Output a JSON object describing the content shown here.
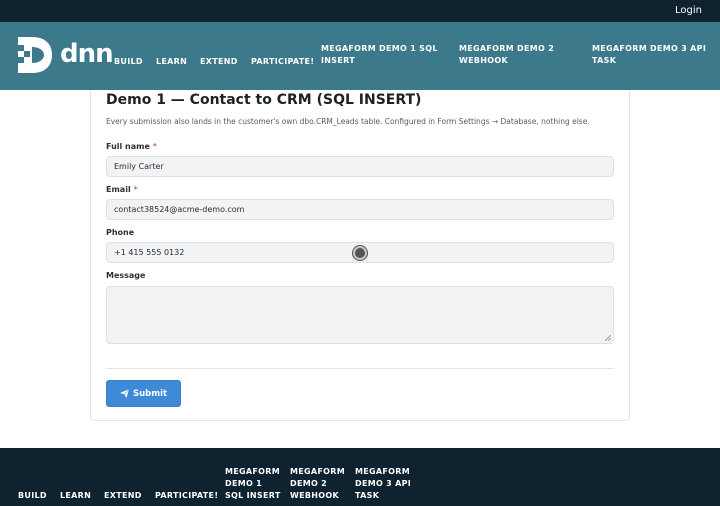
{
  "topbar": {
    "login_label": "Login"
  },
  "header": {
    "logo_text": "dnn",
    "nav": [
      {
        "label": "BUILD"
      },
      {
        "label": "LEARN"
      },
      {
        "label": "EXTEND"
      },
      {
        "label": "PARTICIPATE!"
      },
      {
        "label_line1": "MEGAFORM DEMO 1 SQL",
        "label_line2": "INSERT"
      },
      {
        "label_line1": "MEGAFORM DEMO 2",
        "label_line2": "WEBHOOK"
      },
      {
        "label_line1": "MEGAFORM DEMO 3 API",
        "label_line2": "TASK"
      }
    ]
  },
  "form": {
    "title": "Demo 1 — Contact to CRM (SQL INSERT)",
    "description": "Every submission also lands in the customer's own dbo.CRM_Leads table. Configured in Form Settings → Database, nothing else.",
    "fields": [
      {
        "label": "Full name",
        "required_mark": "*",
        "value": "Emily Carter"
      },
      {
        "label": "Email",
        "required_mark": "*",
        "value": "contact38524@acme-demo.com"
      },
      {
        "label": "Phone",
        "value": "+1 415 555 0132"
      },
      {
        "label": "Message",
        "value": ""
      }
    ],
    "submit_label": "Submit"
  },
  "footer": {
    "nav": [
      {
        "label": "BUILD"
      },
      {
        "label": "LEARN"
      },
      {
        "label": "EXTEND"
      },
      {
        "label": "PARTICIPATE!"
      },
      {
        "line1": "MEGAFORM",
        "line2": "DEMO 1",
        "line3": "SQL INSERT"
      },
      {
        "line1": "MEGAFORM",
        "line2": "DEMO 2",
        "line3": "WEBHOOK"
      },
      {
        "line1": "MEGAFORM",
        "line2": "DEMO 3 API",
        "line3": "TASK"
      }
    ]
  },
  "colors": {
    "topbar": "#0e2230",
    "header": "#3c7a8b",
    "button": "#3f8ad6",
    "footer": "#0e2230"
  }
}
